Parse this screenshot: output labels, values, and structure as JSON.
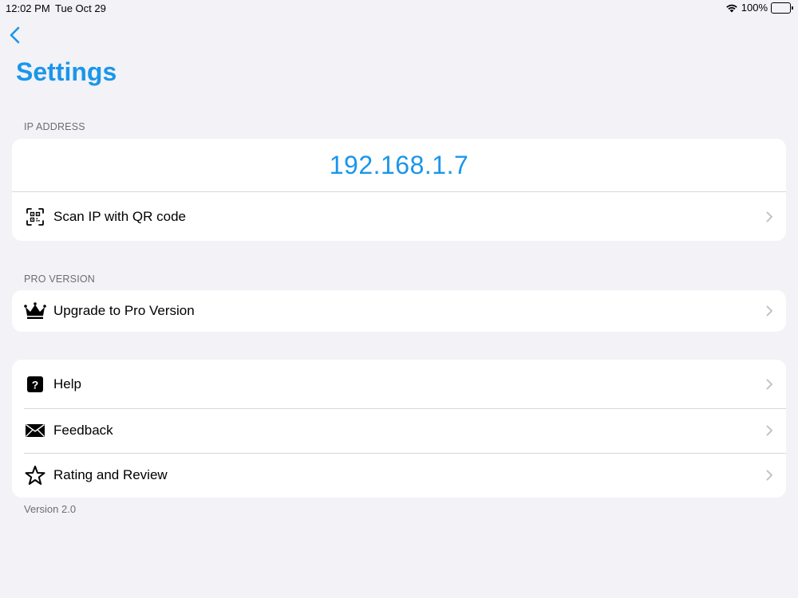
{
  "status_bar": {
    "time": "12:02 PM",
    "date": "Tue Oct 29",
    "battery": "100%",
    "battery_level": 1.0
  },
  "nav": {
    "title": "Settings"
  },
  "ip_section": {
    "header": "IP ADDRESS",
    "ip_address": "192.168.1.7",
    "scan_label": "Scan IP with QR code"
  },
  "pro_section": {
    "header": "PRO VERSION",
    "upgrade_label": "Upgrade to Pro Version"
  },
  "support_section": {
    "items": [
      {
        "label": "Help",
        "icon": "help-icon"
      },
      {
        "label": "Feedback",
        "icon": "envelope-icon"
      },
      {
        "label": "Rating and Review",
        "icon": "star-icon"
      }
    ]
  },
  "footer": {
    "version": "Version 2.0"
  },
  "colors": {
    "accent": "#1a96eb",
    "background": "#f2f2f7",
    "card": "#ffffff",
    "secondary_text": "#6d6d72",
    "chevron": "#c4c4c7"
  }
}
